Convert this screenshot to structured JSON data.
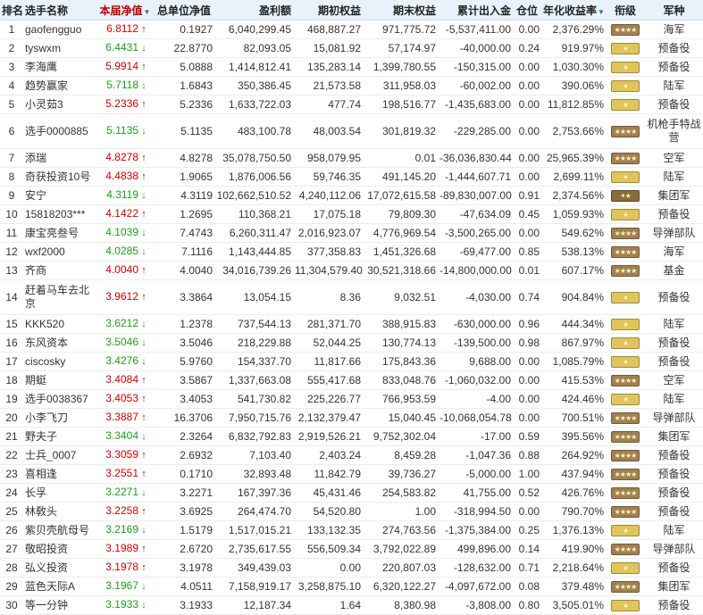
{
  "header": {
    "rank": "排名",
    "name": "选手名称",
    "nav": "本届净值",
    "unit_nav": "总单位净值",
    "profit": "盈利额",
    "begin_equity": "期初权益",
    "end_equity": "期末权益",
    "cum_inout": "累计出入金",
    "position": "仓位",
    "annual": "年化收益率",
    "rank_title": "衔级",
    "branch": "军种",
    "sort_icon": "sort-down-arrow-icon"
  },
  "colors": {
    "up": "#d40000",
    "down": "#1a9f1a",
    "header_bg": "#e8f2fa"
  },
  "rows": [
    {
      "rank": "1",
      "name": "gaofengguo",
      "nav": "6.8112",
      "dir": "up",
      "unit_nav": "0.1927",
      "profit": "6,040,299.45",
      "begin": "468,887.27",
      "end": "971,775.72",
      "inout": "-5,537,411.00",
      "pos": "0.00",
      "annual": "2,376.29%",
      "badge": "brown",
      "branch": "海军"
    },
    {
      "rank": "2",
      "name": "tyswxm",
      "nav": "6.4431",
      "dir": "down",
      "unit_nav": "22.8770",
      "profit": "82,093.05",
      "begin": "15,081.92",
      "end": "57,174.97",
      "inout": "-40,000.00",
      "pos": "0.24",
      "annual": "919.97%",
      "badge": "yellow",
      "branch": "预备役"
    },
    {
      "rank": "3",
      "name": "李海鹰",
      "nav": "5.9914",
      "dir": "up",
      "unit_nav": "5.0888",
      "profit": "1,414,812.41",
      "begin": "135,283.14",
      "end": "1,399,780.55",
      "inout": "-150,315.00",
      "pos": "0.00",
      "annual": "1,030.30%",
      "badge": "yellow",
      "branch": "预备役"
    },
    {
      "rank": "4",
      "name": "趋势赢家",
      "nav": "5.7118",
      "dir": "down",
      "unit_nav": "1.6843",
      "profit": "350,386.45",
      "begin": "21,573.58",
      "end": "311,958.03",
      "inout": "-60,002.00",
      "pos": "0.00",
      "annual": "390.06%",
      "badge": "yellow",
      "branch": "陆军"
    },
    {
      "rank": "5",
      "name": "小灵茹3",
      "nav": "5.2336",
      "dir": "up",
      "unit_nav": "5.2336",
      "profit": "1,633,722.03",
      "begin": "477.74",
      "end": "198,516.77",
      "inout": "-1,435,683.00",
      "pos": "0.00",
      "annual": "11,812.85%",
      "badge": "yellow",
      "branch": "预备役"
    },
    {
      "rank": "6",
      "name": "选手0000885",
      "nav": "5.1135",
      "dir": "down",
      "unit_nav": "5.1135",
      "profit": "483,100.78",
      "begin": "48,003.54",
      "end": "301,819.32",
      "inout": "-229,285.00",
      "pos": "0.00",
      "annual": "2,753.66%",
      "badge": "brown",
      "branch": "机枪手特战营",
      "tall": true
    },
    {
      "rank": "7",
      "name": "添瑞",
      "nav": "4.8278",
      "dir": "up",
      "unit_nav": "4.8278",
      "profit": "35,078,750.50",
      "begin": "958,079.95",
      "end": "0.01",
      "inout": "-36,036,830.44",
      "pos": "0.00",
      "annual": "25,965.39%",
      "badge": "brown",
      "branch": "空军"
    },
    {
      "rank": "8",
      "name": "奇获投资10号",
      "nav": "4.4838",
      "dir": "up",
      "unit_nav": "1.9065",
      "profit": "1,876,006.56",
      "begin": "59,746.35",
      "end": "491,145.20",
      "inout": "-1,444,607.71",
      "pos": "0.00",
      "annual": "2,699.11%",
      "badge": "yellow",
      "branch": "陆军"
    },
    {
      "rank": "9",
      "name": "安宁",
      "nav": "4.3119",
      "dir": "down",
      "unit_nav": "4.3119",
      "profit": "102,662,510.52",
      "begin": "4,240,112.06",
      "end": "17,072,615.58",
      "inout": "-89,830,007.00",
      "pos": "0.91",
      "annual": "2,374.56%",
      "badge": "dark",
      "branch": "集团军"
    },
    {
      "rank": "10",
      "name": "15818203***",
      "nav": "4.1422",
      "dir": "up",
      "unit_nav": "1.2695",
      "profit": "110,368.21",
      "begin": "17,075.18",
      "end": "79,809.30",
      "inout": "-47,634.09",
      "pos": "0.45",
      "annual": "1,059.93%",
      "badge": "yellow",
      "branch": "预备役"
    },
    {
      "rank": "11",
      "name": "康宝亮叁号",
      "nav": "4.1039",
      "dir": "down",
      "unit_nav": "7.4743",
      "profit": "6,260,311.47",
      "begin": "2,016,923.07",
      "end": "4,776,969.54",
      "inout": "-3,500,265.00",
      "pos": "0.00",
      "annual": "549.62%",
      "badge": "brown",
      "branch": "导弹部队"
    },
    {
      "rank": "12",
      "name": "wxf2000",
      "nav": "4.0285",
      "dir": "down",
      "unit_nav": "7.1116",
      "profit": "1,143,444.85",
      "begin": "377,358.83",
      "end": "1,451,326.68",
      "inout": "-69,477.00",
      "pos": "0.85",
      "annual": "538.13%",
      "badge": "brown",
      "branch": "海军"
    },
    {
      "rank": "13",
      "name": "齐商",
      "nav": "4.0040",
      "dir": "up",
      "unit_nav": "4.0040",
      "profit": "34,016,739.26",
      "begin": "11,304,579.40",
      "end": "30,521,318.66",
      "inout": "-14,800,000.00",
      "pos": "0.01",
      "annual": "607.17%",
      "badge": "brown",
      "branch": "基金"
    },
    {
      "rank": "14",
      "name": "赶着马车去北京",
      "nav": "3.9612",
      "dir": "up",
      "unit_nav": "3.3864",
      "profit": "13,054.15",
      "begin": "8.36",
      "end": "9,032.51",
      "inout": "-4,030.00",
      "pos": "0.74",
      "annual": "904.84%",
      "badge": "yellow",
      "branch": "预备役",
      "tall": true
    },
    {
      "rank": "15",
      "name": "KKK520",
      "nav": "3.6212",
      "dir": "down",
      "unit_nav": "1.2378",
      "profit": "737,544.13",
      "begin": "281,371.70",
      "end": "388,915.83",
      "inout": "-630,000.00",
      "pos": "0.96",
      "annual": "444.34%",
      "badge": "yellow",
      "branch": "陆军"
    },
    {
      "rank": "16",
      "name": "东风资本",
      "nav": "3.5046",
      "dir": "down",
      "unit_nav": "3.5046",
      "profit": "218,229.88",
      "begin": "52,044.25",
      "end": "130,774.13",
      "inout": "-139,500.00",
      "pos": "0.98",
      "annual": "867.97%",
      "badge": "yellow",
      "branch": "预备役"
    },
    {
      "rank": "17",
      "name": "ciscosky",
      "nav": "3.4276",
      "dir": "down",
      "unit_nav": "5.9760",
      "profit": "154,337.70",
      "begin": "11,817.66",
      "end": "175,843.36",
      "inout": "9,688.00",
      "pos": "0.00",
      "annual": "1,085.79%",
      "badge": "yellow",
      "branch": "预备役"
    },
    {
      "rank": "18",
      "name": "期蜓",
      "nav": "3.4084",
      "dir": "up",
      "unit_nav": "3.5867",
      "profit": "1,337,663.08",
      "begin": "555,417.68",
      "end": "833,048.76",
      "inout": "-1,060,032.00",
      "pos": "0.00",
      "annual": "415.53%",
      "badge": "brown",
      "branch": "空军"
    },
    {
      "rank": "19",
      "name": "选手0038367",
      "nav": "3.4053",
      "dir": "up",
      "unit_nav": "3.4053",
      "profit": "541,730.82",
      "begin": "225,226.77",
      "end": "766,953.59",
      "inout": "-4.00",
      "pos": "0.00",
      "annual": "424.46%",
      "badge": "yellow",
      "branch": "陆军"
    },
    {
      "rank": "20",
      "name": "小李飞刀",
      "nav": "3.3887",
      "dir": "up",
      "unit_nav": "16.3706",
      "profit": "7,950,715.76",
      "begin": "2,132,379.47",
      "end": "15,040.45",
      "inout": "-10,068,054.78",
      "pos": "0.00",
      "annual": "700.51%",
      "badge": "brown",
      "branch": "导弹部队"
    },
    {
      "rank": "21",
      "name": "野夫子",
      "nav": "3.3404",
      "dir": "down",
      "unit_nav": "2.3264",
      "profit": "6,832,792.83",
      "begin": "2,919,526.21",
      "end": "9,752,302.04",
      "inout": "-17.00",
      "pos": "0.59",
      "annual": "395.56%",
      "badge": "brown",
      "branch": "集团军"
    },
    {
      "rank": "22",
      "name": "士兵_0007",
      "nav": "3.3059",
      "dir": "up",
      "unit_nav": "2.6932",
      "profit": "7,103.40",
      "begin": "2,403.24",
      "end": "8,459.28",
      "inout": "-1,047.36",
      "pos": "0.88",
      "annual": "264.92%",
      "badge": "brown",
      "branch": "预备役"
    },
    {
      "rank": "23",
      "name": "喜相逢",
      "nav": "3.2551",
      "dir": "up",
      "unit_nav": "0.1710",
      "profit": "32,893.48",
      "begin": "11,842.79",
      "end": "39,736.27",
      "inout": "-5,000.00",
      "pos": "1.00",
      "annual": "437.94%",
      "badge": "brown",
      "branch": "预备役"
    },
    {
      "rank": "24",
      "name": "长孚",
      "nav": "3.2271",
      "dir": "down",
      "unit_nav": "3.2271",
      "profit": "167,397.36",
      "begin": "45,431.46",
      "end": "254,583.82",
      "inout": "41,755.00",
      "pos": "0.52",
      "annual": "426.76%",
      "badge": "brown",
      "branch": "预备役"
    },
    {
      "rank": "25",
      "name": "林敎头",
      "nav": "3.2258",
      "dir": "up",
      "unit_nav": "3.6925",
      "profit": "264,474.70",
      "begin": "54,520.80",
      "end": "1.00",
      "inout": "-318,994.50",
      "pos": "0.00",
      "annual": "790.70%",
      "badge": "brown",
      "branch": "预备役"
    },
    {
      "rank": "26",
      "name": "紫贝壳航母号",
      "nav": "3.2169",
      "dir": "down",
      "unit_nav": "1.5179",
      "profit": "1,517,015.21",
      "begin": "133,132.35",
      "end": "274,763.56",
      "inout": "-1,375,384.00",
      "pos": "0.25",
      "annual": "1,376.13%",
      "badge": "yellow",
      "branch": "陆军"
    },
    {
      "rank": "27",
      "name": "敬昭投资",
      "nav": "3.1989",
      "dir": "up",
      "unit_nav": "2.6720",
      "profit": "2,735,617.55",
      "begin": "556,509.34",
      "end": "3,792,022.89",
      "inout": "499,896.00",
      "pos": "0.14",
      "annual": "419.90%",
      "badge": "brown",
      "branch": "导弹部队"
    },
    {
      "rank": "28",
      "name": "弘义投资",
      "nav": "3.1978",
      "dir": "up",
      "unit_nav": "3.1978",
      "profit": "349,439.03",
      "begin": "0.00",
      "end": "220,807.03",
      "inout": "-128,632.00",
      "pos": "0.71",
      "annual": "2,218.64%",
      "badge": "yellow",
      "branch": "预备役"
    },
    {
      "rank": "29",
      "name": "蓝色天际A",
      "nav": "3.1967",
      "dir": "down",
      "unit_nav": "4.0511",
      "profit": "7,158,919.17",
      "begin": "3,258,875.10",
      "end": "6,320,122.27",
      "inout": "-4,097,672.00",
      "pos": "0.08",
      "annual": "379.48%",
      "badge": "brown",
      "branch": "集团军"
    },
    {
      "rank": "30",
      "name": "等一分钟",
      "nav": "3.1933",
      "dir": "down",
      "unit_nav": "3.1933",
      "profit": "12,187.34",
      "begin": "1.64",
      "end": "8,380.98",
      "inout": "-3,808.00",
      "pos": "0.80",
      "annual": "3,505.01%",
      "badge": "yellow",
      "branch": "预备役"
    }
  ]
}
